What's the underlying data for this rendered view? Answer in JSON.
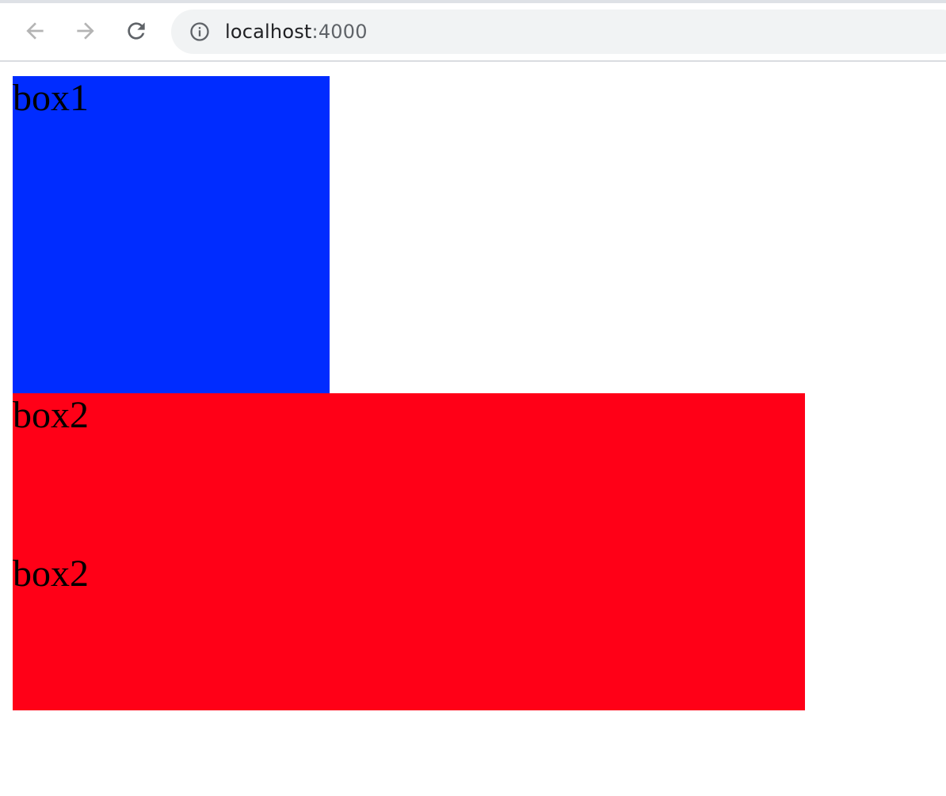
{
  "browser": {
    "url_host": "localhost",
    "url_rest": ":4000",
    "icons": {
      "back": "arrow-left-icon",
      "forward": "arrow-right-icon",
      "reload": "reload-icon",
      "site_info": "info-circle-icon"
    },
    "colors": {
      "toolbar_bg": "#ffffff",
      "omnibox_bg": "#f1f3f4",
      "icon_disabled": "#b4b4b4",
      "icon_active": "#5f6368"
    }
  },
  "page": {
    "box1": {
      "label": "box1",
      "color": "#002cff"
    },
    "box2": {
      "labels": [
        "box2",
        "box2"
      ],
      "color": "#ff0017"
    }
  }
}
